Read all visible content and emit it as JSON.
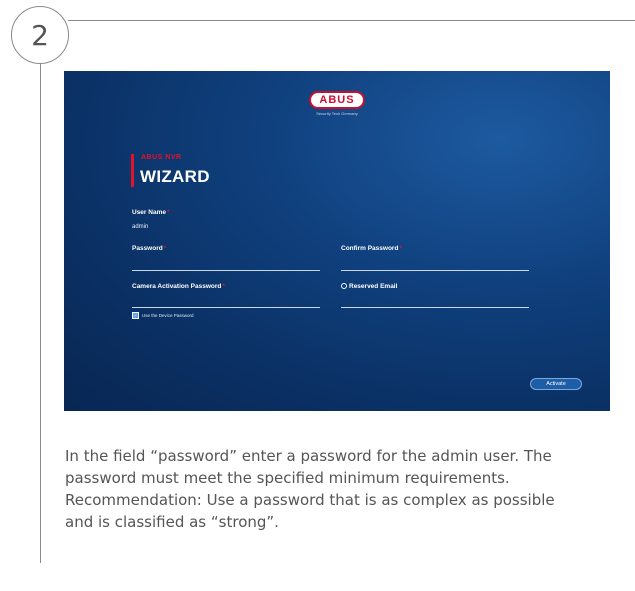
{
  "step_number": "2",
  "screen": {
    "logo_text": "ABUS",
    "logo_tagline": "Security Tech Germany",
    "brand_subtitle": "ABUS NVR",
    "wizard_title": "WIZARD",
    "fields": {
      "username_label": "User Name",
      "username_value": "admin",
      "password_label": "Password",
      "confirm_password_label": "Confirm Password",
      "camera_activation_label": "Camera Activation Password",
      "reserved_email_label": "Reserved Email",
      "required_marker": "*"
    },
    "checkbox_label": "Use the Device Password",
    "activate_button": "Activate"
  },
  "caption": "In the field “password” enter a password for the admin user. The password must meet the specified minimum requirements. Recommendation: Use a password that is as complex as possible and is classified as “strong”."
}
